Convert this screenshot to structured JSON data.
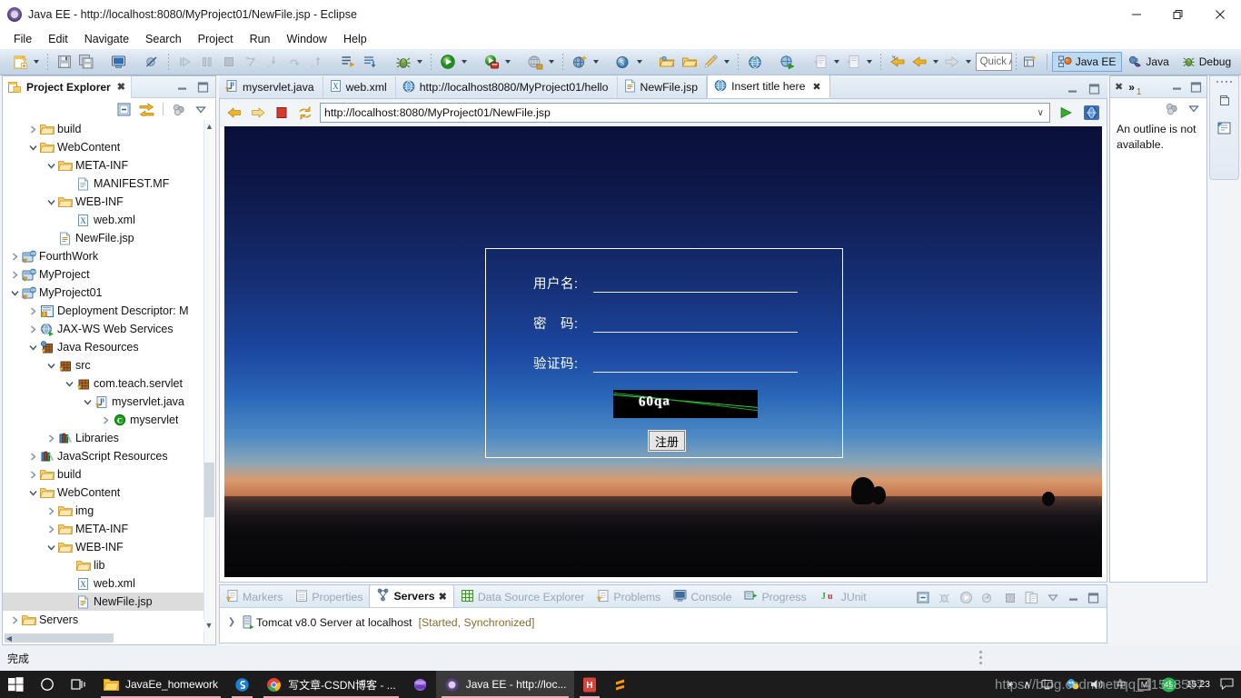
{
  "window": {
    "title": "Java EE - http://localhost:8080/MyProject01/NewFile.jsp - Eclipse",
    "minimize": "—",
    "maximize": "❐",
    "close": "✕"
  },
  "menu": [
    "File",
    "Edit",
    "Navigate",
    "Search",
    "Project",
    "Run",
    "Window",
    "Help"
  ],
  "toolbar": {
    "quick_access": "Quick Access",
    "perspectives": [
      {
        "label": "Java EE",
        "active": true
      },
      {
        "label": "Java",
        "active": false
      },
      {
        "label": "Debug",
        "active": false
      }
    ]
  },
  "project_explorer": {
    "title": "Project Explorer",
    "close": "✖",
    "tree": [
      {
        "label": "build",
        "indent": 1,
        "twist": "collapsed",
        "icon": "folder"
      },
      {
        "label": "WebContent",
        "indent": 1,
        "twist": "expanded",
        "icon": "folder"
      },
      {
        "label": "META-INF",
        "indent": 2,
        "twist": "expanded",
        "icon": "folder"
      },
      {
        "label": "MANIFEST.MF",
        "indent": 3,
        "twist": "none",
        "icon": "file"
      },
      {
        "label": "WEB-INF",
        "indent": 2,
        "twist": "expanded",
        "icon": "folder"
      },
      {
        "label": "web.xml",
        "indent": 3,
        "twist": "none",
        "icon": "xml"
      },
      {
        "label": "NewFile.jsp",
        "indent": 2,
        "twist": "none",
        "icon": "jsp"
      },
      {
        "label": "FourthWork",
        "indent": 0,
        "twist": "collapsed",
        "icon": "project"
      },
      {
        "label": "MyProject",
        "indent": 0,
        "twist": "collapsed",
        "icon": "project"
      },
      {
        "label": "MyProject01",
        "indent": 0,
        "twist": "expanded",
        "icon": "project"
      },
      {
        "label": "Deployment Descriptor: M",
        "indent": 1,
        "twist": "collapsed",
        "icon": "deploy"
      },
      {
        "label": "JAX-WS Web Services",
        "indent": 1,
        "twist": "collapsed",
        "icon": "jaxws"
      },
      {
        "label": "Java Resources",
        "indent": 1,
        "twist": "expanded",
        "icon": "javares"
      },
      {
        "label": "src",
        "indent": 2,
        "twist": "expanded",
        "icon": "srcfolder"
      },
      {
        "label": "com.teach.servlet",
        "indent": 3,
        "twist": "expanded",
        "icon": "package"
      },
      {
        "label": "myservlet.java",
        "indent": 4,
        "twist": "expanded",
        "icon": "javafile"
      },
      {
        "label": "myservlet",
        "indent": 5,
        "twist": "collapsed",
        "icon": "class"
      },
      {
        "label": "Libraries",
        "indent": 2,
        "twist": "collapsed",
        "icon": "library"
      },
      {
        "label": "JavaScript Resources",
        "indent": 1,
        "twist": "collapsed",
        "icon": "library"
      },
      {
        "label": "build",
        "indent": 1,
        "twist": "collapsed",
        "icon": "folder"
      },
      {
        "label": "WebContent",
        "indent": 1,
        "twist": "expanded",
        "icon": "folder"
      },
      {
        "label": "img",
        "indent": 2,
        "twist": "collapsed",
        "icon": "folder"
      },
      {
        "label": "META-INF",
        "indent": 2,
        "twist": "collapsed",
        "icon": "folder"
      },
      {
        "label": "WEB-INF",
        "indent": 2,
        "twist": "expanded",
        "icon": "folder"
      },
      {
        "label": "lib",
        "indent": 3,
        "twist": "none",
        "icon": "folder"
      },
      {
        "label": "web.xml",
        "indent": 3,
        "twist": "none",
        "icon": "xml"
      },
      {
        "label": "NewFile.jsp",
        "indent": 3,
        "twist": "none",
        "icon": "jsp",
        "selected": true
      },
      {
        "label": "Servers",
        "indent": 0,
        "twist": "collapsed",
        "icon": "folder"
      }
    ]
  },
  "editor": {
    "tabs": [
      {
        "label": "myservlet.java",
        "icon": "javafile",
        "active": false
      },
      {
        "label": "web.xml",
        "icon": "xml",
        "active": false
      },
      {
        "label": "http://localhost8080/MyProject01/hello",
        "icon": "globe",
        "active": false
      },
      {
        "label": "NewFile.jsp",
        "icon": "jsp",
        "active": false
      },
      {
        "label": "Insert title here",
        "icon": "globe",
        "active": true,
        "close": "✖"
      }
    ],
    "url": "http://localhost:8080/MyProject01/NewFile.jsp",
    "dropdown_caret": "∨"
  },
  "page": {
    "fields": [
      {
        "label": "用户名:"
      },
      {
        "label": "密　码:"
      },
      {
        "label": "验证码:"
      }
    ],
    "captcha_text": "60qa",
    "submit_label": "注册"
  },
  "bottom_panel": {
    "tabs": [
      {
        "label": "Markers",
        "icon": "marker",
        "active": false
      },
      {
        "label": "Properties",
        "icon": "props",
        "active": false
      },
      {
        "label": "Servers",
        "icon": "servers",
        "active": true,
        "close": "✖"
      },
      {
        "label": "Data Source Explorer",
        "icon": "datasrc",
        "active": false
      },
      {
        "label": "Problems",
        "icon": "marker",
        "active": false
      },
      {
        "label": "Console",
        "icon": "console",
        "active": false
      },
      {
        "label": "Progress",
        "icon": "progress",
        "active": false
      },
      {
        "label": "JUnit",
        "icon": "junit",
        "active": false
      }
    ],
    "server_row": {
      "name": "Tomcat v8.0 Server at localhost",
      "state": "[Started, Synchronized]"
    }
  },
  "outline": {
    "message": "An outline is not available.",
    "close": "✖",
    "overflow": "»",
    "overflow_count": "1"
  },
  "status_bar": {
    "text": "完成"
  },
  "taskbar": {
    "items": [
      {
        "label": "",
        "icon": "windows-start",
        "active": false
      },
      {
        "label": "",
        "icon": "search-circle",
        "active": false
      },
      {
        "label": "",
        "icon": "task-view",
        "active": false
      },
      {
        "label": "JavaEe_homework",
        "icon": "folder-yellow",
        "active": false,
        "running": true
      },
      {
        "label": "",
        "icon": "sogou",
        "active": false
      },
      {
        "label": "写文章-CSDN博客 - ...",
        "icon": "chrome",
        "active": false,
        "running": true
      },
      {
        "label": "",
        "icon": "purple-orb",
        "active": false
      },
      {
        "label": "Java EE - http://loc...",
        "icon": "eclipse",
        "active": true,
        "running": true
      },
      {
        "label": "",
        "icon": "hbuilder",
        "active": false,
        "running": true
      },
      {
        "label": "",
        "icon": "sublime",
        "active": false
      }
    ],
    "tray": {
      "people": "⚹",
      "chevron": "∧",
      "clock_time": "15:23",
      "clock_date": "",
      "badge": "45"
    }
  },
  "watermark": {
    "text": "https://blog.csdn.net/qq_41518597"
  },
  "colors": {
    "accent": "#1c47a0",
    "toolbar_top": "#e9f0f8",
    "toolbar_bottom": "#c3d3e4",
    "selection": "#dcdcdc",
    "captcha_line": "#2ecc40",
    "status_started": "#8a6b2a"
  }
}
